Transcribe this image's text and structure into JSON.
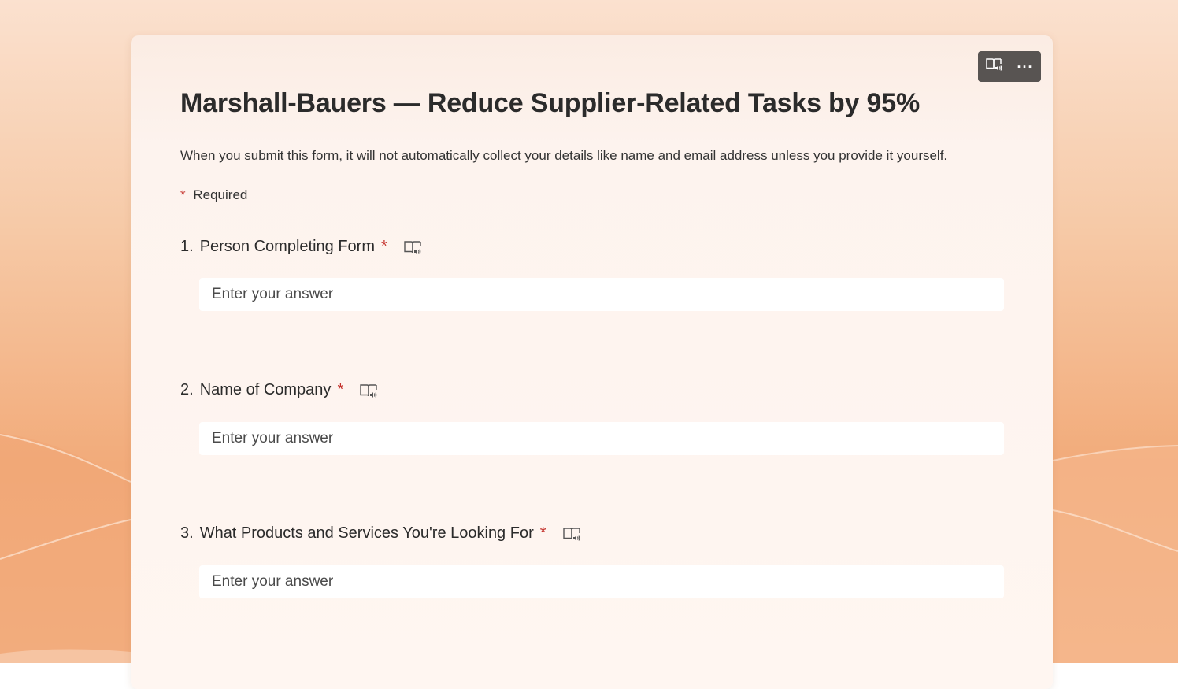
{
  "colors": {
    "accent_red": "#c4312b",
    "toolbar_bg": "#585452",
    "background_peach": "#f2ab7a"
  },
  "toolbar": {
    "reader_icon": "immersive-reader-icon",
    "more_icon": "more-options-icon",
    "more_label": "···"
  },
  "form": {
    "title": "Marshall-Bauers — Reduce Supplier-Related Tasks by 95%",
    "description": "When you submit this form, it will not automatically collect your details like name and email address unless you provide it yourself.",
    "required_star": "*",
    "required_label": "Required"
  },
  "questions": [
    {
      "number": "1.",
      "label": "Person Completing Form",
      "required": "*",
      "placeholder": "Enter your answer",
      "icon": "immersive-reader-icon"
    },
    {
      "number": "2.",
      "label": "Name of Company",
      "required": "*",
      "placeholder": "Enter your answer",
      "icon": "immersive-reader-icon"
    },
    {
      "number": "3.",
      "label": "What Products and Services You're Looking For",
      "required": "*",
      "placeholder": "Enter your answer",
      "icon": "immersive-reader-icon"
    }
  ]
}
